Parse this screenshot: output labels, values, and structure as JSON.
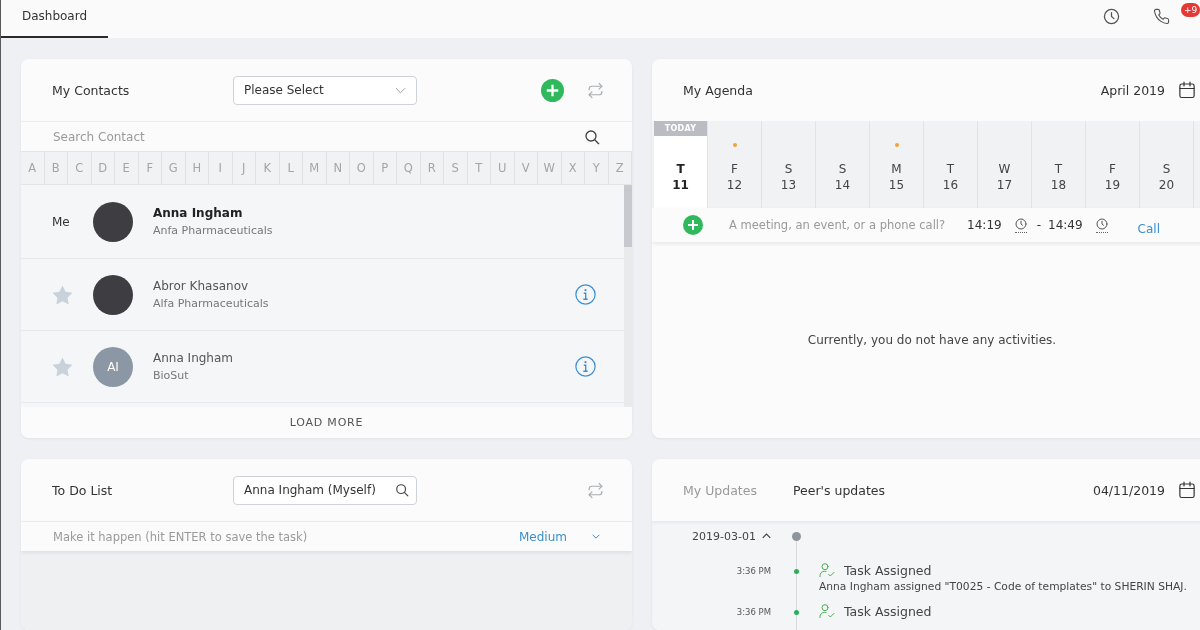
{
  "topbar": {
    "tabs": [
      {
        "label": "Dashboard",
        "selected": true
      }
    ],
    "badge": "+9"
  },
  "contacts": {
    "title": "My Contacts",
    "filter": {
      "label": "Please Select"
    },
    "search": {
      "placeholder": "Search Contact"
    },
    "letters": [
      {
        "letter": "A",
        "selected": false
      },
      {
        "letter": "B",
        "selected": false
      },
      {
        "letter": "C",
        "selected": false
      },
      {
        "letter": "D",
        "selected": false
      },
      {
        "letter": "E",
        "selected": false
      },
      {
        "letter": "F",
        "selected": false
      },
      {
        "letter": "G",
        "selected": false
      },
      {
        "letter": "H",
        "selected": false
      },
      {
        "letter": "I",
        "selected": false
      },
      {
        "letter": "J",
        "selected": false
      },
      {
        "letter": "K",
        "selected": false
      },
      {
        "letter": "L",
        "selected": false
      },
      {
        "letter": "M",
        "selected": false
      },
      {
        "letter": "N",
        "selected": false
      },
      {
        "letter": "O",
        "selected": false
      },
      {
        "letter": "P",
        "selected": false
      },
      {
        "letter": "Q",
        "selected": false
      },
      {
        "letter": "R",
        "selected": false
      },
      {
        "letter": "S",
        "selected": false
      },
      {
        "letter": "T",
        "selected": false
      },
      {
        "letter": "U",
        "selected": false
      },
      {
        "letter": "V",
        "selected": false
      },
      {
        "letter": "W",
        "selected": false
      },
      {
        "letter": "X",
        "selected": false
      },
      {
        "letter": "Y",
        "selected": false
      },
      {
        "letter": "Z",
        "selected": false
      }
    ],
    "rows": [
      {
        "kind": "self",
        "tag": "Me",
        "name": "Anna Ingham",
        "company": "Anfa Pharmaceuticals"
      },
      {
        "kind": "contact",
        "favorite": false,
        "name": "Abror Khasanov",
        "company": "Alfa Pharmaceuticals"
      },
      {
        "kind": "contact",
        "favorite": false,
        "initials": "AI",
        "name": "Anna Ingham",
        "company": "BioSut"
      }
    ],
    "load_more": "LOAD MORE"
  },
  "agenda": {
    "title": "My Agenda",
    "month": "April 2019",
    "today_label": "TODAY",
    "days": [
      {
        "weekday": "T",
        "date": "11",
        "selected": true,
        "has_events": false
      },
      {
        "weekday": "F",
        "date": "12",
        "selected": false,
        "has_events": true
      },
      {
        "weekday": "S",
        "date": "13",
        "selected": false,
        "has_events": false
      },
      {
        "weekday": "S",
        "date": "14",
        "selected": false,
        "has_events": false
      },
      {
        "weekday": "M",
        "date": "15",
        "selected": false,
        "has_events": true
      },
      {
        "weekday": "T",
        "date": "16",
        "selected": false,
        "has_events": false
      },
      {
        "weekday": "W",
        "date": "17",
        "selected": false,
        "has_events": false
      },
      {
        "weekday": "T",
        "date": "18",
        "selected": false,
        "has_events": false
      },
      {
        "weekday": "F",
        "date": "19",
        "selected": false,
        "has_events": false
      },
      {
        "weekday": "S",
        "date": "20",
        "selected": false,
        "has_events": false
      }
    ],
    "quick_add": {
      "placeholder": "A meeting, an event, or a phone call?",
      "start": "14:19",
      "separator": "-",
      "end": "14:49",
      "type": "Call"
    },
    "empty_message": "Currently, you do not have any activities."
  },
  "todo": {
    "title": "To Do List",
    "assignee": {
      "value": "Anna Ingham (Myself)"
    },
    "new_task": {
      "placeholder": "Make it happen (hit ENTER to save the task)"
    },
    "priority": "Medium"
  },
  "updates": {
    "tabs": [
      {
        "label": "My Updates",
        "selected": false
      },
      {
        "label": "Peer's updates",
        "selected": true
      }
    ],
    "date": "04/11/2019",
    "groups": [
      {
        "date": "2019-03-01",
        "expanded": true,
        "items": [
          {
            "time": "3:36 PM",
            "title": "Task Assigned",
            "text": "Anna Ingham assigned \"T0025 - Code of templates\" to SHERIN SHAJ."
          },
          {
            "time": "3:36 PM",
            "title": "Task Assigned"
          }
        ]
      }
    ]
  }
}
